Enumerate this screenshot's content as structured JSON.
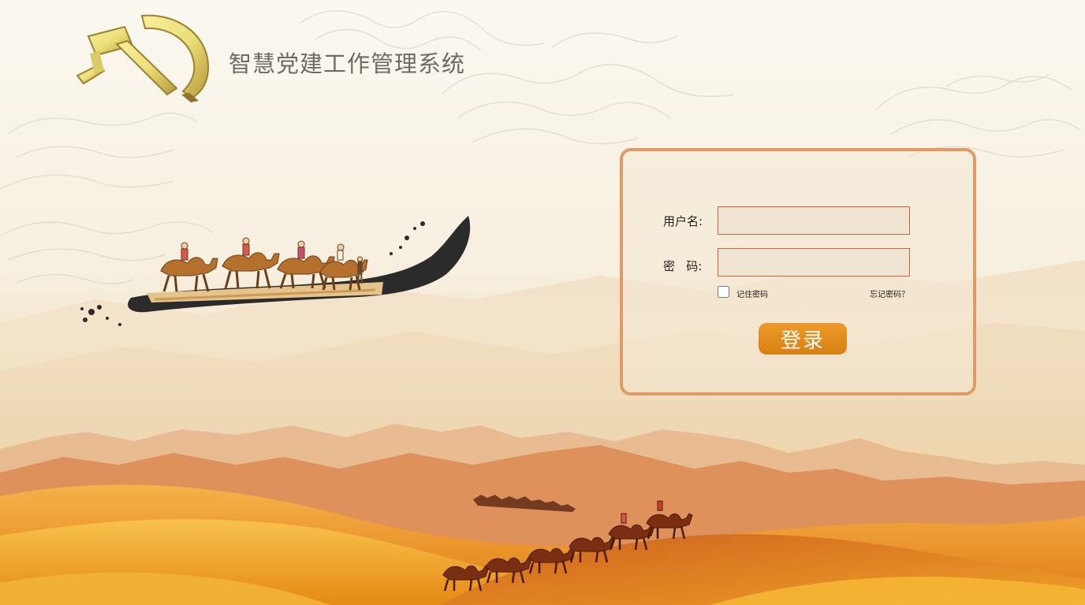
{
  "app": {
    "title": "智慧党建工作管理系统"
  },
  "login": {
    "username_label": "用户名:",
    "username_value": "",
    "password_label": "密   码:",
    "password_value": "",
    "remember_label": "记住密码",
    "remember_checked": false,
    "forgot_label": "忘记密码？",
    "submit_label": "登录"
  },
  "icons": {
    "emblem": "party-emblem-icon"
  },
  "colors": {
    "panel_border": "#e09a68",
    "input_border": "#d0603a",
    "button": "#dd8418",
    "title_text": "#6f6a64",
    "desert": "#ec9a1c"
  }
}
